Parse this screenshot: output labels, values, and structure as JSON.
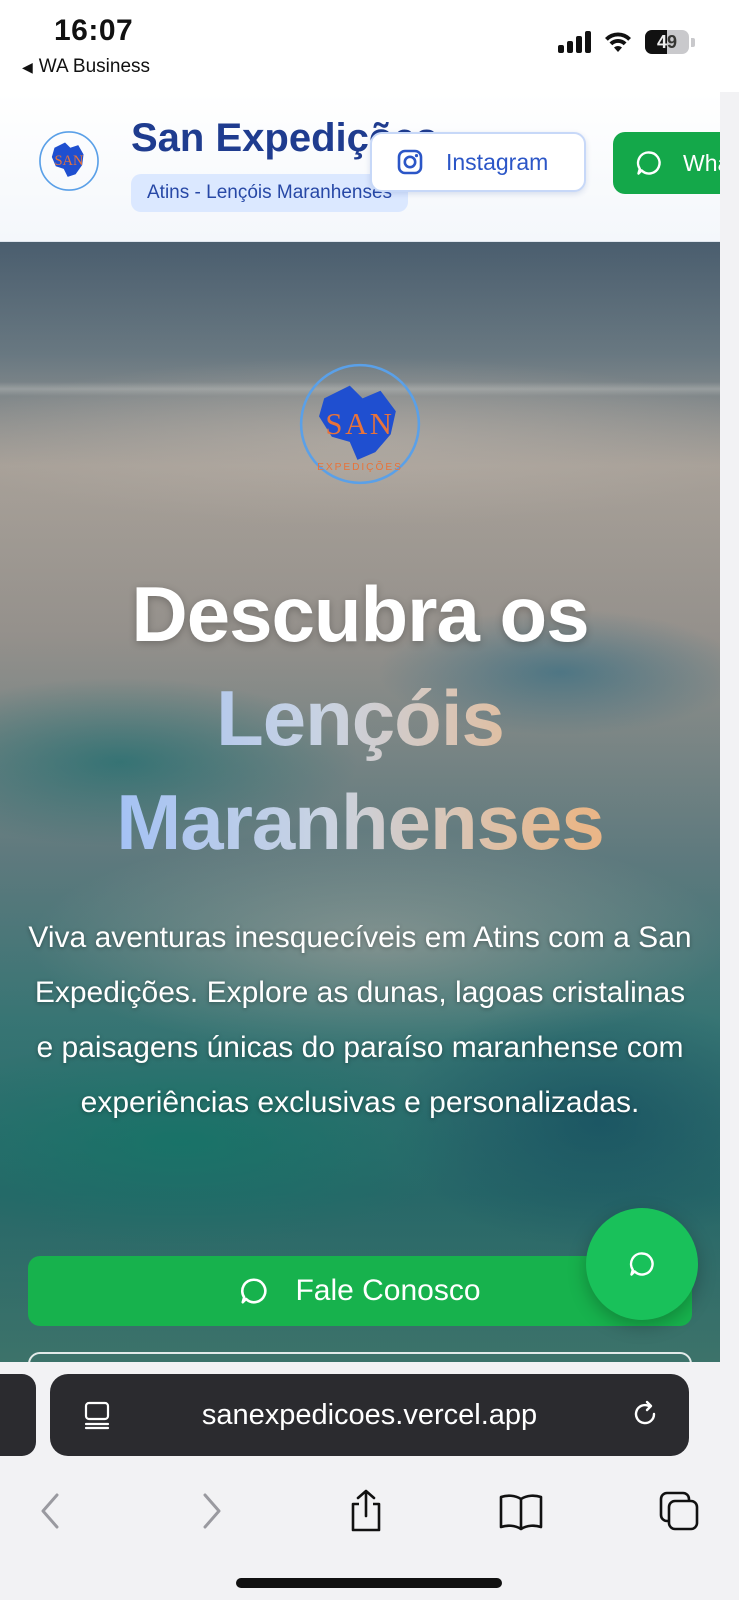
{
  "status_bar": {
    "time": "16:07",
    "back_app": "WA Business",
    "battery": "49",
    "battery_fraction": 0.49
  },
  "header": {
    "brand": "San Expedições",
    "tagline": "Atins - Lençóis Maranhenses",
    "instagram_label": "Instagram",
    "whatsapp_label": "WhatsApp"
  },
  "logo": {
    "text": "SAN",
    "subtext": "EXPEDIÇÕES",
    "map_color": "#1f4fd0",
    "ring_color": "#5aa0e8",
    "text_color": "#e8733a"
  },
  "hero": {
    "title_line1": "Descubra os",
    "title_line2": "Lençóis",
    "title_line3": "Maranhenses",
    "description": "Viva aventuras inesquecíveis em Atins com a San Expedições. Explore as dunas, lagoas cristalinas e paisagens únicas do paraíso maranhense com experiências exclusivas e personalizadas.",
    "cta_label": "Fale Conosco"
  },
  "browser": {
    "url": "sanexpedicoes.vercel.app"
  },
  "colors": {
    "brand_blue": "#1f3c8f",
    "whatsapp_green": "#17b24d",
    "float_green": "#19c15a"
  },
  "icons": {
    "instagram": "instagram-icon",
    "whatsapp": "whatsapp-chat-icon",
    "reader": "reader-icon",
    "reload": "reload-icon",
    "back": "chevron-left-icon",
    "forward": "chevron-right-icon",
    "share": "share-icon",
    "bookmarks": "book-icon",
    "tabs": "tabs-icon"
  }
}
